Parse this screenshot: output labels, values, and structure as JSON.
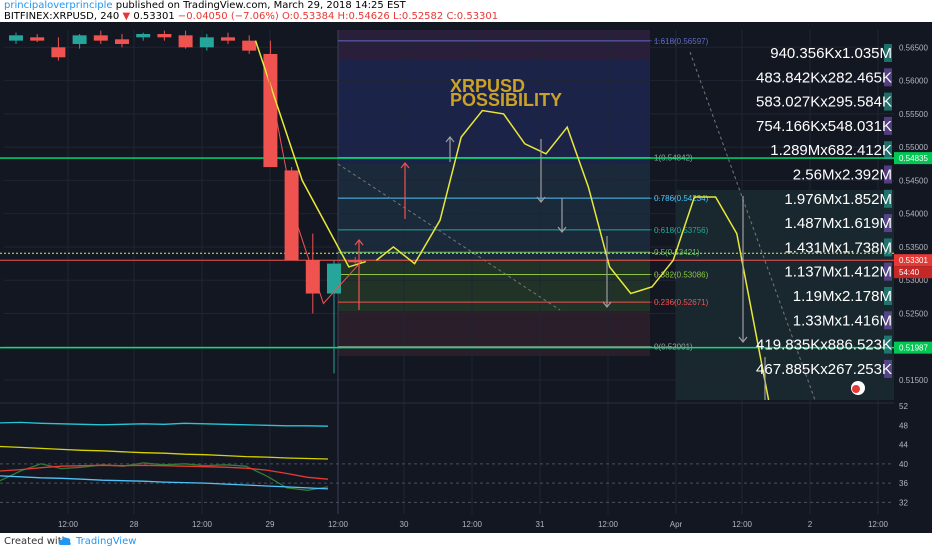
{
  "header": {
    "author": "principaloverprinciple",
    "published": "published on TradingView.com, March 29, 2018 14:25 EST",
    "symbol": "BITFINEX:XRPUSD, 240",
    "last": "0.53301",
    "change": "−0.04050 (−7.06%)",
    "ohlc": "O:0.53384 H:0.54626 L:0.52582 C:0.53301"
  },
  "footer": {
    "created_with": "Created with",
    "brand": "TradingView"
  },
  "annotation": {
    "line1": "XRPUSD",
    "line2": "POSSIBILITY"
  },
  "colors": {
    "up": "#26a69a",
    "down": "#ef5350",
    "projection": "#e8e83a",
    "level": "#00e676",
    "text": "#ffffff",
    "annotation": "#c9a227"
  },
  "chart_data": [
    {
      "type": "candlestick",
      "title": "BITFINEX:XRPUSD, 240",
      "ylim": [
        0.512,
        0.567
      ],
      "y_ticks": [
        "0.56500",
        "0.56000",
        "0.55500",
        "0.55000",
        "0.54500",
        "0.54000",
        "0.53500",
        "0.53000",
        "0.52500",
        "0.52000",
        "0.51500"
      ],
      "x_labels": [
        "12:00",
        "28",
        "12:00",
        "29",
        "12:00",
        "30",
        "12:00",
        "31",
        "12:00",
        "Apr",
        "12:00",
        "2",
        "12:00"
      ],
      "candles": [
        {
          "i": 0,
          "o": 0.566,
          "h": 0.5672,
          "l": 0.5655,
          "c": 0.5668
        },
        {
          "i": 1,
          "o": 0.5665,
          "h": 0.567,
          "l": 0.5658,
          "c": 0.566
        },
        {
          "i": 2,
          "o": 0.565,
          "h": 0.5665,
          "l": 0.563,
          "c": 0.5635
        },
        {
          "i": 3,
          "o": 0.5655,
          "h": 0.567,
          "l": 0.5648,
          "c": 0.5668
        },
        {
          "i": 4,
          "o": 0.5668,
          "h": 0.5675,
          "l": 0.5655,
          "c": 0.566
        },
        {
          "i": 5,
          "o": 0.5662,
          "h": 0.567,
          "l": 0.565,
          "c": 0.5655
        },
        {
          "i": 6,
          "o": 0.5665,
          "h": 0.5672,
          "l": 0.566,
          "c": 0.567
        },
        {
          "i": 7,
          "o": 0.567,
          "h": 0.5675,
          "l": 0.566,
          "c": 0.5665
        },
        {
          "i": 8,
          "o": 0.5668,
          "h": 0.5675,
          "l": 0.5648,
          "c": 0.565
        },
        {
          "i": 9,
          "o": 0.565,
          "h": 0.567,
          "l": 0.5645,
          "c": 0.5665
        },
        {
          "i": 10,
          "o": 0.5665,
          "h": 0.5672,
          "l": 0.5655,
          "c": 0.566
        },
        {
          "i": 11,
          "o": 0.566,
          "h": 0.5668,
          "l": 0.564,
          "c": 0.5645
        },
        {
          "i": 12,
          "o": 0.564,
          "h": 0.566,
          "l": 0.554,
          "c": 0.547
        },
        {
          "i": 13,
          "o": 0.5465,
          "h": 0.547,
          "l": 0.535,
          "c": 0.533
        },
        {
          "i": 14,
          "o": 0.533,
          "h": 0.537,
          "l": 0.525,
          "c": 0.528
        },
        {
          "i": 15,
          "o": 0.528,
          "h": 0.533,
          "l": 0.516,
          "c": 0.5325
        },
        {
          "i": 16,
          "o": 0.533,
          "h": 0.5335,
          "l": 0.5325,
          "c": 0.5328
        }
      ],
      "levels": [
        {
          "price": 0.54835,
          "label": "0.54835",
          "color": "#00e676"
        },
        {
          "price": 0.51987,
          "label": "0.51987",
          "color": "#00e676"
        },
        {
          "price": 0.53301,
          "label": "0.53301",
          "color": "#ef5350"
        }
      ],
      "fibonacci": [
        {
          "ratio": "1.618",
          "price": 0.56597,
          "label": "1.618(0.56597)"
        },
        {
          "ratio": "1",
          "price": 0.54842,
          "label": "1(0.54842)"
        },
        {
          "ratio": "0.786",
          "price": 0.54234,
          "label": "0.786(0.54234)"
        },
        {
          "ratio": "0.618",
          "price": 0.53756,
          "label": "0.618(0.53756)"
        },
        {
          "ratio": "0.5",
          "price": 0.53421,
          "label": "0.5(0.53421)"
        },
        {
          "ratio": "0.382",
          "price": 0.53086,
          "label": "0.382(0.53086)"
        },
        {
          "ratio": "0.236",
          "price": 0.52671,
          "label": "0.236(0.52671)"
        },
        {
          "ratio": "0",
          "price": 0.52001,
          "label": "0(0.52001)"
        }
      ],
      "projection_path": [
        {
          "t": 17.0,
          "p": 0.533
        },
        {
          "t": 17.8,
          "p": 0.535
        },
        {
          "t": 18.8,
          "p": 0.5325
        },
        {
          "t": 20.0,
          "p": 0.539
        },
        {
          "t": 21.0,
          "p": 0.5515
        },
        {
          "t": 22.0,
          "p": 0.5555
        },
        {
          "t": 23.0,
          "p": 0.555
        },
        {
          "t": 24.0,
          "p": 0.5505
        },
        {
          "t": 25.0,
          "p": 0.549
        },
        {
          "t": 26.0,
          "p": 0.553
        },
        {
          "t": 27.0,
          "p": 0.544
        },
        {
          "t": 28.0,
          "p": 0.532
        },
        {
          "t": 29.0,
          "p": 0.528
        },
        {
          "t": 30.0,
          "p": 0.529
        },
        {
          "t": 31.0,
          "p": 0.533
        },
        {
          "t": 32.0,
          "p": 0.5425
        },
        {
          "t": 33.0,
          "p": 0.5425
        },
        {
          "t": 34.0,
          "p": 0.537
        },
        {
          "t": 35.5,
          "p": 0.512
        }
      ],
      "volume_profile": [
        "940.356Kx1.035M",
        "483.842Kx282.465K",
        "583.027Kx295.584K",
        "754.166Kx548.031K",
        "1.289Mx682.412K",
        "2.56Mx2.392M",
        "1.976Mx1.852M",
        "1.487Mx1.619M",
        "1.431Mx1.738M",
        "1.137Mx1.412M",
        "1.19Mx2.178M",
        "1.33Mx1.416M",
        "419.835Kx886.523K",
        "467.885Kx267.253K"
      ],
      "price_badges": [
        "54:40"
      ]
    },
    {
      "type": "line",
      "title": "",
      "ylim": [
        30,
        52
      ],
      "y_ticks": [
        "52",
        "48",
        "44",
        "40",
        "36",
        "32"
      ],
      "series": [
        {
          "color": "#26c6da",
          "values": [
            48.5,
            48.6,
            48.4,
            48.3,
            48.2,
            48.1,
            48.2,
            48.3,
            48.2,
            48.4,
            48.3,
            48.2,
            48.1,
            48.0,
            47.9,
            47.9,
            47.8
          ]
        },
        {
          "color": "#d4d400",
          "values": [
            43.6,
            43.4,
            43.2,
            43.0,
            42.8,
            42.7,
            42.5,
            42.3,
            42.2,
            42.0,
            41.9,
            41.7,
            41.5,
            41.4,
            41.2,
            41.1,
            41.0
          ]
        },
        {
          "color": "#2e7d32",
          "values": [
            36.5,
            38.5,
            40.0,
            39.0,
            39.3,
            39.8,
            39.5,
            40.2,
            39.8,
            40.0,
            39.6,
            39.8,
            39.5,
            37.5,
            35.0,
            34.5,
            35.2
          ]
        },
        {
          "color": "#e53935",
          "values": [
            38.5,
            38.8,
            39.2,
            39.5,
            39.6,
            39.7,
            39.6,
            39.7,
            39.6,
            39.5,
            39.4,
            39.3,
            39.1,
            38.7,
            38.0,
            37.2,
            36.8
          ]
        },
        {
          "color": "#4fc3f7",
          "values": [
            37.5,
            37.3,
            37.1,
            37.0,
            36.8,
            36.6,
            36.5,
            36.4,
            36.2,
            36.1,
            36.0,
            35.8,
            35.6,
            35.4,
            35.2,
            35.0,
            34.8
          ]
        }
      ]
    }
  ]
}
